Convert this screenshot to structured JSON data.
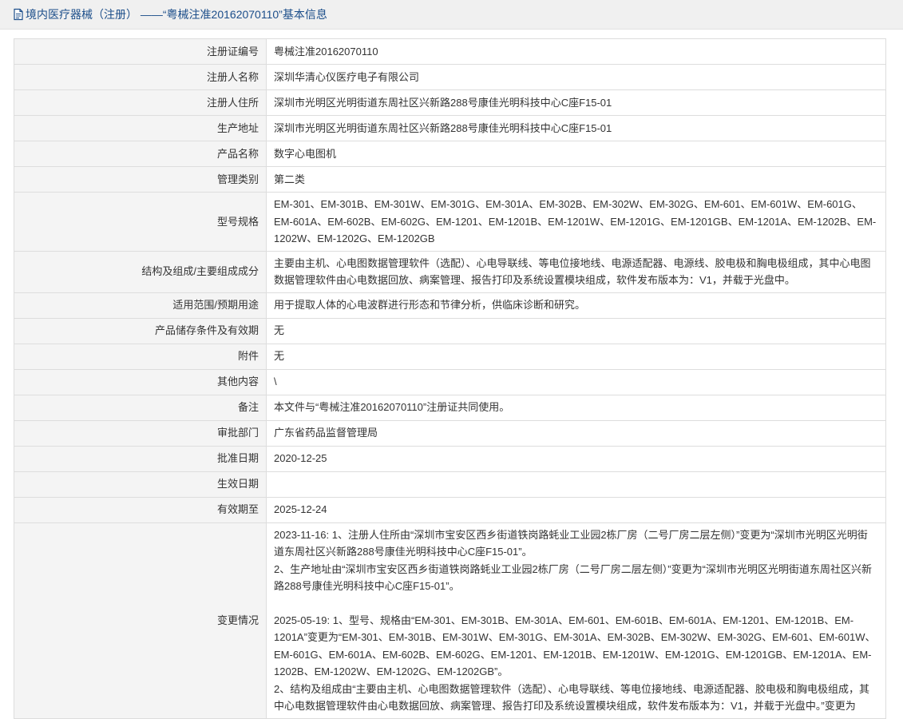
{
  "header": {
    "icon": "document-icon",
    "title": "境内医疗器械（注册） ——“粤械注准20162070110”基本信息"
  },
  "rows": [
    {
      "label": "注册证编号",
      "value": "粤械注准20162070110"
    },
    {
      "label": "注册人名称",
      "value": "深圳华清心仪医疗电子有限公司"
    },
    {
      "label": "注册人住所",
      "value": "深圳市光明区光明街道东周社区兴新路288号康佳光明科技中心C座F15-01"
    },
    {
      "label": "生产地址",
      "value": "深圳市光明区光明街道东周社区兴新路288号康佳光明科技中心C座F15-01"
    },
    {
      "label": "产品名称",
      "value": "数字心电图机"
    },
    {
      "label": "管理类别",
      "value": "第二类"
    },
    {
      "label": "型号规格",
      "value": "EM-301、EM-301B、EM-301W、EM-301G、EM-301A、EM-302B、EM-302W、EM-302G、EM-601、EM-601W、EM-601G、EM-601A、EM-602B、EM-602G、EM-1201、EM-1201B、EM-1201W、EM-1201G、EM-1201GB、EM-1201A、EM-1202B、EM-1202W、EM-1202G、EM-1202GB"
    },
    {
      "label": "结构及组成/主要组成成分",
      "value": "主要由主机、心电图数据管理软件（选配）、心电导联线、等电位接地线、电源适配器、电源线、胶电极和胸电极组成，其中心电图数据管理软件由心电数据回放、病案管理、报告打印及系统设置模块组成，软件发布版本为：V1，并载于光盘中。"
    },
    {
      "label": "适用范围/预期用途",
      "value": "用于提取人体的心电波群进行形态和节律分析，供临床诊断和研究。"
    },
    {
      "label": "产品储存条件及有效期",
      "value": "无"
    },
    {
      "label": "附件",
      "value": "无"
    },
    {
      "label": "其他内容",
      "value": "\\"
    },
    {
      "label": "备注",
      "value": "本文件与“粤械注准20162070110”注册证共同使用。"
    },
    {
      "label": "审批部门",
      "value": "广东省药品监督管理局"
    },
    {
      "label": "批准日期",
      "value": "2020-12-25"
    },
    {
      "label": "生效日期",
      "value": ""
    },
    {
      "label": "有效期至",
      "value": "2025-12-24"
    }
  ],
  "changes": {
    "label": "变更情况",
    "p1": "2023-11-16: 1、注册人住所由“深圳市宝安区西乡街道铁岗路蚝业工业园2栋厂房（二号厂房二层左侧）”变更为“深圳市光明区光明街道东周社区兴新路288号康佳光明科技中心C座F15-01”。",
    "p2": "2、生产地址由“深圳市宝安区西乡街道铁岗路蚝业工业园2栋厂房（二号厂房二层左侧）”变更为“深圳市光明区光明街道东周社区兴新路288号康佳光明科技中心C座F15-01”。",
    "p3": "2025-05-19: 1、型号、规格由“EM-301、EM-301B、EM-301A、EM-601、EM-601B、EM-601A、EM-1201、EM-1201B、EM-1201A”变更为“EM-301、EM-301B、EM-301W、EM-301G、EM-301A、EM-302B、EM-302W、EM-302G、EM-601、EM-601W、EM-601G、EM-601A、EM-602B、EM-602G、EM-1201、EM-1201B、EM-1201W、EM-1201G、EM-1201GB、EM-1201A、EM-1202B、EM-1202W、EM-1202G、EM-1202GB”。",
    "p4": "2、结构及组成由“主要由主机、心电图数据管理软件（选配）、心电导联线、等电位接地线、电源适配器、胶电极和胸电极组成，其中心电数据管理软件由心电数据回放、病案管理、报告打印及系统设置模块组成，软件发布版本为：V1，并载于光盘中。”变更为"
  }
}
